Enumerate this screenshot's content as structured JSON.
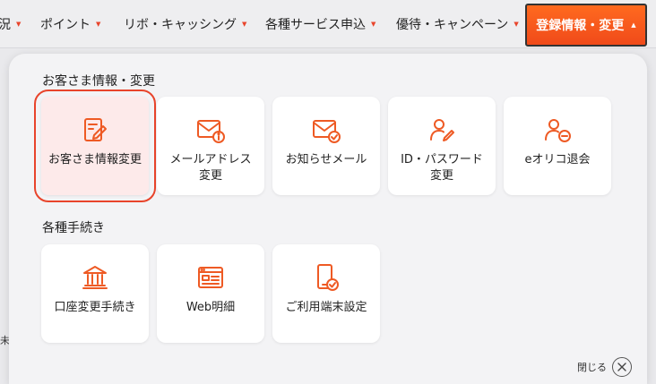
{
  "nav": {
    "items": [
      {
        "label": "況"
      },
      {
        "label": "ポイント"
      },
      {
        "label": "リボ・キャッシング"
      },
      {
        "label": "各種サービス申込"
      },
      {
        "label": "優待・キャンペーン"
      }
    ],
    "active_label": "登録情報・変更",
    "accent": "#e8442b"
  },
  "background_snippet": "未",
  "sections": [
    {
      "title": "お客さま情報・変更",
      "cards": [
        {
          "label": "お客さま情報変更",
          "icon": "document-pen-icon",
          "selected": true
        },
        {
          "label": "メールアドレス\n変更",
          "icon": "mail-info-icon"
        },
        {
          "label": "お知らせメール",
          "icon": "mail-check-icon"
        },
        {
          "label": "ID・パスワード\n変更",
          "icon": "user-edit-icon"
        },
        {
          "label": "eオリコ退会",
          "icon": "user-remove-icon"
        }
      ]
    },
    {
      "title": "各種手続き",
      "cards": [
        {
          "label": "口座変更手続き",
          "icon": "bank-icon"
        },
        {
          "label": "Web明細",
          "icon": "web-statement-icon"
        },
        {
          "label": "ご利用端末設定",
          "icon": "phone-check-icon"
        }
      ]
    }
  ],
  "close": {
    "label": "閉じる",
    "icon": "close-icon"
  }
}
